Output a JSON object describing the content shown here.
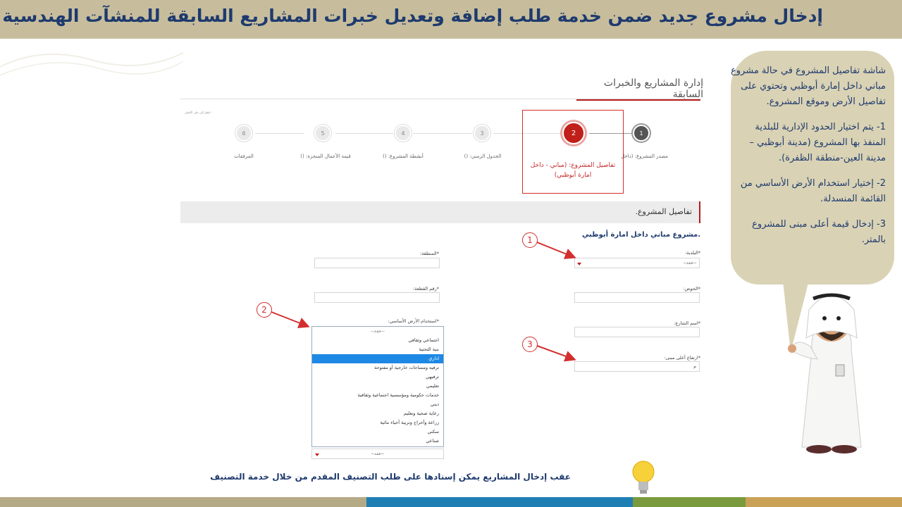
{
  "header": {
    "title": "إدخال مشروع جديد ضمن خدمة طلب إضافة وتعديل خبرات المشاريع السابقة للمنشآت الهندسية"
  },
  "page": {
    "heading": "إدارة المشاريع والخبرات السابقة",
    "step_hint": "- انتقل إلى على الأصلي"
  },
  "steps": [
    {
      "number": "1",
      "label": "مصدر المشروع: (داخل",
      "state": "done"
    },
    {
      "number": "2",
      "label": "تفاصيل المشروع: (مباني - داخل امارة أبوظبي)",
      "state": "active"
    },
    {
      "number": "3",
      "label": "الجدول الزمني: ()",
      "state": "pending"
    },
    {
      "number": "4",
      "label": "أنشطة المشروع: ()",
      "state": "pending"
    },
    {
      "number": "5",
      "label": "قيمة الأعمال المنجزة: ()",
      "state": "pending"
    },
    {
      "number": "6",
      "label": "المرفقات",
      "state": "pending"
    }
  ],
  "section": {
    "title": "تفاصيل المشروع.",
    "subtitle": ".مشروع مباني داخل امارة أبوظبي"
  },
  "form": {
    "municipality_label": "*البلدية:",
    "municipality_value": "--حدد--",
    "region_label": "*المنطقة:",
    "basin_label": "*الحوض:",
    "plot_label": "*رقم القطعة:",
    "street_label": "*اسم الشارع:",
    "land_use_label": "*استخدام الأرض الأساسي:",
    "height_label": "*ارتفاع أعلى مبنى:",
    "height_value": "م",
    "land_use_collapsed": "--حدد--"
  },
  "land_use_options": [
    "--حدد--",
    "اجتماعي وثقافي",
    "بنية التحتية",
    "اداري",
    "ترفيه ومساحات خارجية أو مفتوحة",
    "ترفيهي",
    "تعليمي",
    "خدمات حكومية ومؤسسية اجتماعية وثقافية",
    "ديني",
    "رعاية صحية وتعليم",
    "زراعة وأحراج وتربية أحياء مائية",
    "سكني",
    "صناعي"
  ],
  "land_use_selected_index": 3,
  "markers": [
    "1",
    "2",
    "3"
  ],
  "bubble": {
    "intro": "شاشة تفاصيل المشروع في حالة مشروع مباني داخل إمارة أبوظبي وتحتوي على تفاصيل الأرض وموقع المشروع.",
    "point1": "1- يتم اختيار الحدود الإدارية للبلدية المنفذ بها المشروع (مدينة أبوظبي – مدينة العين-منطقة الظفرة).",
    "point2": "2- إختيار استخدام الأرض الأساسي من القائمة المنسدلة.",
    "point3": "3- إدخال قيمة أعلى مبنى للمشروع بالمتر."
  },
  "footnote": "عقب إدخال المشاريع يمكن إسنادها على طلب التصنيف المقدم من خلال خدمة التصنيف",
  "colors": {
    "banner": "#c7bd9c",
    "title": "#1e3a6e",
    "accent_red": "#c01f1a",
    "stripe": [
      "#b5aa86",
      "#1f7fb5",
      "#7a9a3e",
      "#c9a257"
    ]
  }
}
